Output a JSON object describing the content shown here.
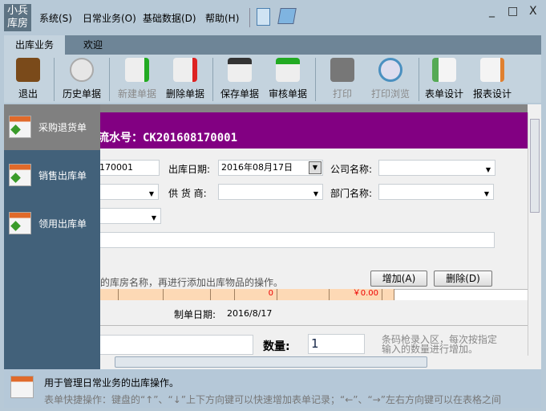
{
  "app": {
    "logo": "小兵库房",
    "menus": [
      "系统(S)",
      "日常业务(O)",
      "基础数据(D)",
      "帮助(H)"
    ],
    "window_controls": [
      "_",
      "□",
      "X"
    ]
  },
  "tabs": [
    "出库业务",
    "欢迎"
  ],
  "toolbar": [
    {
      "label": "退出",
      "enabled": true
    },
    {
      "label": "历史单据",
      "enabled": true
    },
    {
      "label": "新建单据",
      "enabled": false
    },
    {
      "label": "删除单据",
      "enabled": true
    },
    {
      "label": "保存单据",
      "enabled": true
    },
    {
      "label": "审核单据",
      "enabled": true
    },
    {
      "label": "打印",
      "enabled": false
    },
    {
      "label": "打印浏览",
      "enabled": false
    },
    {
      "label": "表单设计",
      "enabled": true
    },
    {
      "label": "报表设计",
      "enabled": true
    }
  ],
  "sidebar": [
    "采购退货单",
    "销售出库单",
    "领用出库单"
  ],
  "form": {
    "banner": "流水号：CK201608170001",
    "doc_no_value": "170001",
    "date_label": "出库日期:",
    "date_value": "2016年08月17日",
    "company_label": "公司名称:",
    "supplier_label": "供 货 商:",
    "dept_label": "部门名称:",
    "hint": "的库房名称，再进行添加出库物品的操作。",
    "add_btn": "增加(A)",
    "del_btn": "删除(D)",
    "row_qty": "0",
    "row_amount": "￥0.00",
    "made_date_label": "制单日期:",
    "made_date_value": "2016/8/17",
    "qty_label": "数量:",
    "qty_value": "1",
    "barcode_hint1": "条码枪录入区，每次按指定",
    "barcode_hint2": "输入的数量进行增加。"
  },
  "status": {
    "line1": "用于管理日常业务的出库操作。",
    "line2": "表单快捷操作：键盘的“↑”、“↓”上下方向键可以快速增加表单记录；“←”、“→”左右方向键可以在表格之间"
  }
}
